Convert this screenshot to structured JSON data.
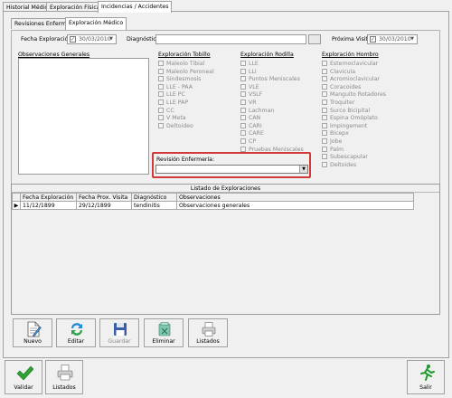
{
  "top_tabs": [
    "Historial Médico",
    "Exploración Física",
    "Incidencias / Accidentes"
  ],
  "sub_tabs": [
    "Revisiones Enfermería",
    "Exploración Médico"
  ],
  "form": {
    "fecha_exploracion_label": "Fecha Exploración:",
    "fecha_exploracion_value": "30/03/2010",
    "diagnostico_label": "Diagnóstico:",
    "diagnostico_value": "",
    "proxima_visita_label": "Próxima Visita:",
    "proxima_visita_value": "30/03/2010",
    "observaciones_label": "Observaciones Generales",
    "revision_label": "Revisión Enfermería:",
    "revision_value": ""
  },
  "tobillo": {
    "title": "Exploración Tobillo",
    "items": [
      "Maleolo Tibial",
      "Maleolo Peroneal",
      "Sindesmosis",
      "LLE - PAA",
      "LLE PC",
      "LLE PAP",
      "CC",
      "V Meta",
      "Deltoideo"
    ]
  },
  "rodilla": {
    "title": "Exploración Rodilla",
    "items": [
      "LLE",
      "LLI",
      "Puntos Meniscales",
      "VLE",
      "VSLF",
      "VR",
      "Lachman",
      "CAN",
      "CARI",
      "CARE",
      "CP",
      "Pruebas Meniscales"
    ]
  },
  "hombro": {
    "title": "Exploración Hombro",
    "items": [
      "Esternoclavicular",
      "Clavicula",
      "Acromioclavicular",
      "Coracoides",
      "Manguito Rotadores",
      "Troquiter",
      "Surco Bicipital",
      "Espina Omóplato",
      "Impingement",
      "Bicepx",
      "Jobe",
      "Palm",
      "Subescapular",
      "Deltoides"
    ]
  },
  "listado": {
    "caption": "Listado de Exploraciones",
    "columns": [
      "Fecha Exploración",
      "Fecha Prox. Visita",
      "Diagnóstico",
      "Observaciones"
    ],
    "rows": [
      [
        "11/12/1899",
        "29/12/1899",
        "tendinitis",
        "Observaciones generales"
      ]
    ]
  },
  "actions": {
    "nuevo": "Nuevo",
    "editar": "Editar",
    "guardar": "Guardar",
    "eliminar": "Eliminar",
    "listados": "Listados"
  },
  "footer": {
    "validar": "Validar",
    "listados": "Listados",
    "salir": "Salir"
  }
}
